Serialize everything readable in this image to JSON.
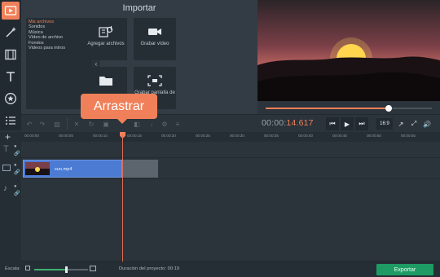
{
  "import": {
    "title": "Importar",
    "categories": [
      "Mis archivos",
      "Sonidos",
      "Música",
      "Vídeo de archivo",
      "Fondos",
      "Videos para intros"
    ],
    "tiles": [
      {
        "label": "Agregar archivos",
        "icon": "add-files-icon"
      },
      {
        "label": "Grabar vídeo",
        "icon": "camera-icon"
      },
      {
        "label": "",
        "icon": "folder-icon"
      },
      {
        "label": "Grabar pantalla de",
        "icon": "screen-capture-icon"
      }
    ]
  },
  "callout": {
    "label": "Arrastrar"
  },
  "player": {
    "time_prefix": "00:00:",
    "time_value": "14.617",
    "aspect": "16:9",
    "seek_progress": 0.74
  },
  "timeline": {
    "ticks": [
      "00:00:00",
      "00:00:05",
      "00:00:10",
      "00:00:15",
      "00:00:20",
      "00:00:25",
      "00:00:30",
      "00:00:35",
      "00:00:40",
      "00:00:45",
      "00:00:50",
      "00:00:55"
    ],
    "clip_name": "sun.mp4"
  },
  "bottom": {
    "scale_label": "Escala:",
    "zoom_level": 0.58,
    "duration_label": "Duración del proyecto:",
    "duration_value": "00:19",
    "export_label": "Exportar"
  },
  "colors": {
    "accent": "#f0805a",
    "clip": "#4c7bd4",
    "export": "#1e9b64"
  }
}
